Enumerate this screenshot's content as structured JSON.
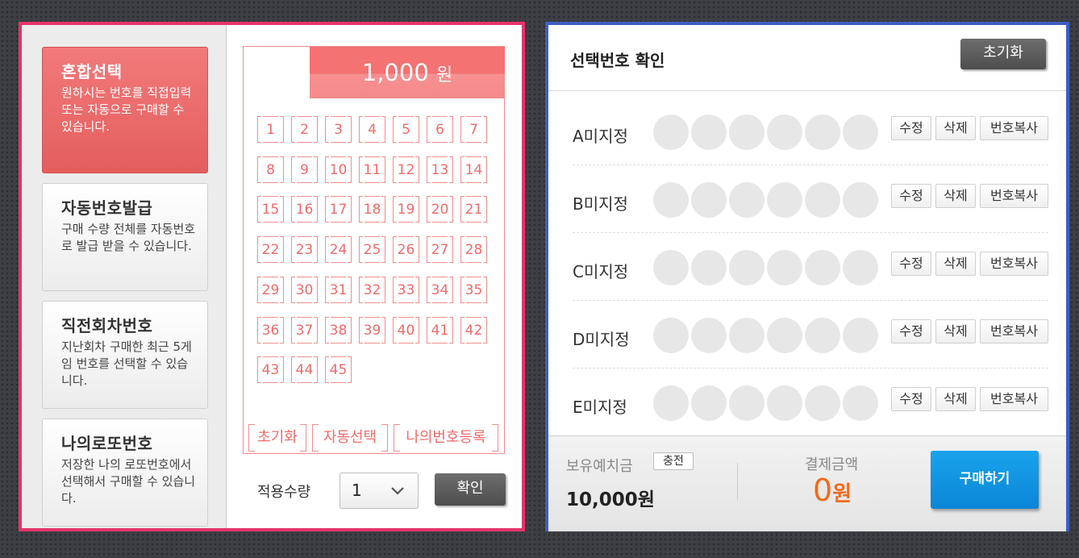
{
  "modes": [
    {
      "title": "혼합선택",
      "desc": "원하시는 번호를 직접입력 또는 자동으로 구매할 수 있습니다."
    },
    {
      "title": "자동번호발급",
      "desc": "구매 수량 전체를 자동번호로 발급 받을 수 있습니다."
    },
    {
      "title": "직전회차번호",
      "desc": "지난회차 구매한 최근 5게임 번호를 선택할 수 있습니다."
    },
    {
      "title": "나의로또번호",
      "desc": "저장한 나의 로또번호에서 선택해서 구매할 수 있습니다."
    }
  ],
  "ticket": {
    "price": "1,000",
    "price_unit": "원",
    "numbers": [
      "1",
      "2",
      "3",
      "4",
      "5",
      "6",
      "7",
      "8",
      "9",
      "10",
      "11",
      "12",
      "13",
      "14",
      "15",
      "16",
      "17",
      "18",
      "19",
      "20",
      "21",
      "22",
      "23",
      "24",
      "25",
      "26",
      "27",
      "28",
      "29",
      "30",
      "31",
      "32",
      "33",
      "34",
      "35",
      "36",
      "37",
      "38",
      "39",
      "40",
      "41",
      "42",
      "43",
      "44",
      "45"
    ],
    "reset_label": "초기화",
    "auto_label": "자동선택",
    "register_label": "나의번호등록"
  },
  "apply": {
    "qty_label": "적용수량",
    "qty_value": "1",
    "confirm_label": "확인"
  },
  "selection": {
    "title": "선택번호 확인",
    "reset_label": "초기화",
    "rows": [
      {
        "label": "A미지정"
      },
      {
        "label": "B미지정"
      },
      {
        "label": "C미지정"
      },
      {
        "label": "D미지정"
      },
      {
        "label": "E미지정"
      }
    ],
    "edit_label": "수정",
    "delete_label": "삭제",
    "copy_label": "번호복사"
  },
  "footer": {
    "balance_label": "보유예치금",
    "charge_label": "충전",
    "balance_value": "10,000원",
    "pay_label": "결제금액",
    "pay_value": "0",
    "pay_unit": "원",
    "buy_label": "구매하기"
  }
}
